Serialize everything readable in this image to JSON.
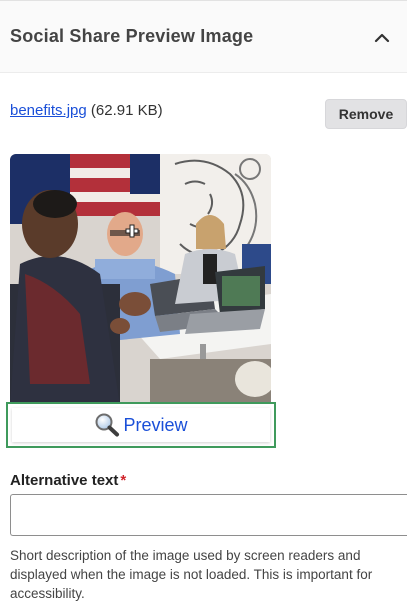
{
  "section": {
    "title": "Social Share Preview Image",
    "toggle_icon": "chevron-up-icon"
  },
  "file": {
    "name": "benefits.jpg",
    "size": "(62.91 KB)",
    "remove_label": "Remove"
  },
  "thumbnail": {
    "description_icon": "photo-thumbnail"
  },
  "preview": {
    "icon": "magnifier-icon",
    "label": "Preview"
  },
  "alt_text": {
    "label": "Alternative text",
    "required_mark": "*",
    "value": "",
    "placeholder": "",
    "help": "Short description of the image used by screen readers and displayed when the image is not loaded. This is important for accessibility."
  },
  "colors": {
    "link": "#1a4fd8",
    "required": "#d0242b",
    "focus_outline": "#3f9a5c",
    "button_bg": "#e2e2e4"
  }
}
